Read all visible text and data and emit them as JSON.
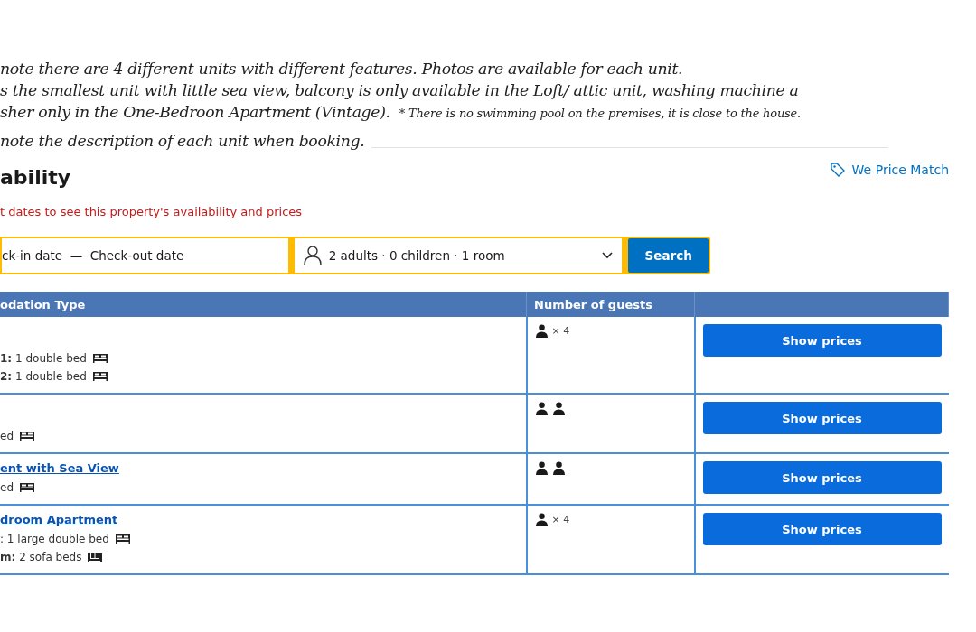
{
  "notes": [
    {
      "text": "note there are 4 different units with different features. Photos are available for each unit."
    },
    {
      "text": "s the smallest unit with little sea view, balcony is only available in the Loft/ attic unit, washing machine a"
    },
    {
      "text": "sher only in the One-Bedroon Apartment (Vintage).",
      "small": "* There is no swimming pool on the premises, it is close to the house."
    },
    {
      "text": "note the description of each unit when booking."
    }
  ],
  "availability": {
    "title": "ability",
    "price_match": "We Price Match",
    "warning": "t dates to see this property's availability and prices"
  },
  "search": {
    "dates": "ck-in date  —  Check-out date",
    "guests": "2 adults · 0 children · 1 room",
    "button": "Search"
  },
  "table": {
    "columns": [
      "odation Type",
      "Number of guests"
    ],
    "rows": [
      {
        "beds": [
          {
            "text": "**1:** 1 double bed",
            "kind": "bed"
          },
          {
            "text": "**2:** 1 double bed",
            "kind": "bed"
          }
        ],
        "guests": {
          "kind": "times",
          "text": "× 4"
        },
        "button": "Show prices"
      },
      {
        "beds": [
          {
            "text": "ed",
            "kind": "bed"
          }
        ],
        "guests": {
          "kind": "pair"
        },
        "button": "Show prices"
      },
      {
        "link": "ent with Sea View",
        "beds": [
          {
            "text": "ed",
            "kind": "bed"
          }
        ],
        "guests": {
          "kind": "pair"
        },
        "button": "Show prices"
      },
      {
        "link": "droom Apartment",
        "beds": [
          {
            "text": ": 1 large double bed",
            "kind": "bed"
          },
          {
            "text": "**m:** 2 sofa beds",
            "kind": "sofa"
          }
        ],
        "guests": {
          "kind": "times",
          "text": "× 4"
        },
        "button": "Show prices"
      }
    ]
  }
}
